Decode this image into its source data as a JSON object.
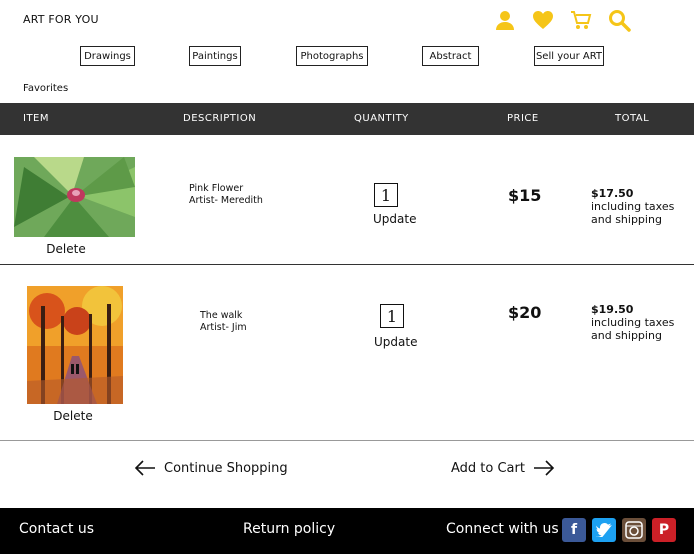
{
  "brand": "ART FOR YOU",
  "header_icons": [
    "user-icon",
    "heart-icon",
    "cart-icon",
    "search-icon"
  ],
  "categories": [
    "Drawings",
    "Paintings",
    "Photographs",
    "Abstract",
    "Sell your ART"
  ],
  "section_label": "Favorites",
  "table_headers": {
    "item": "ITEM",
    "description": "DESCRIPTION",
    "quantity": "QUANTITY",
    "price": "PRICE",
    "total": "TOTAL"
  },
  "rows": [
    {
      "title": "Pink Flower",
      "artist": "Artist- Meredith",
      "quantity": "1",
      "update_label": "Update",
      "price": "$15",
      "total": "$17.50",
      "total_note_1": "including taxes",
      "total_note_2": "and shipping",
      "delete_label": "Delete"
    },
    {
      "title": "The walk",
      "artist": "Artist- Jim",
      "quantity": "1",
      "update_label": "Update",
      "price": "$20",
      "total": "$19.50",
      "total_note_1": "including taxes",
      "total_note_2": "and shipping",
      "delete_label": "Delete"
    }
  ],
  "actions": {
    "continue": "Continue Shopping",
    "add_to_cart": "Add to Cart"
  },
  "footer": {
    "contact": "Contact us",
    "return_policy": "Return policy",
    "connect": "Connect with us :",
    "social": [
      "facebook-icon",
      "twitter-icon",
      "instagram-icon",
      "pinterest-icon"
    ]
  },
  "colors": {
    "accent_yellow": "#f5c518",
    "header_bar": "#333333",
    "footer_bg": "#000000",
    "facebook": "#3b5998",
    "twitter": "#1da1f2",
    "instagram": "#6b4f3a",
    "pinterest": "#cb2027"
  }
}
